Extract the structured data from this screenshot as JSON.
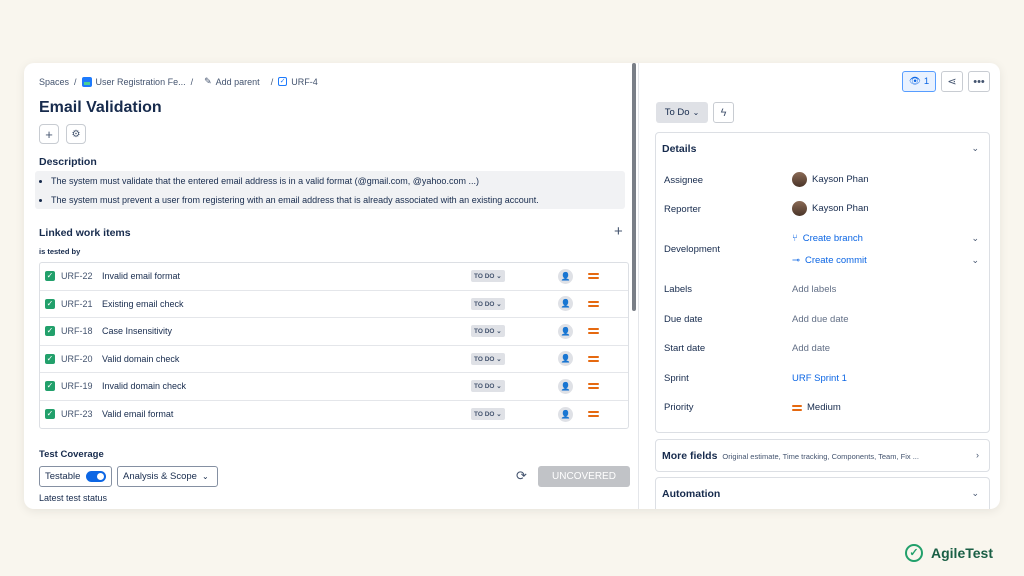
{
  "breadcrumb": {
    "spaces": "Spaces",
    "project": "User Registration Fe...",
    "add_parent": "Add parent",
    "issue_key": "URF-4",
    "separator": "/"
  },
  "issue": {
    "title": "Email Validation"
  },
  "description": {
    "heading": "Description",
    "items": [
      "The system must validate that the entered email address is in a valid format (@gmail.com, @yahoo.com ...)",
      "The system must prevent a user from registering with an email address that is already associated with an existing account."
    ]
  },
  "linked": {
    "heading": "Linked work items",
    "relation": "is tested by",
    "rows": [
      {
        "key": "URF-22",
        "summary": "Invalid email format",
        "status": "TO DO ⌄"
      },
      {
        "key": "URF-21",
        "summary": "Existing email check",
        "status": "TO DO ⌄"
      },
      {
        "key": "URF-18",
        "summary": "Case Insensitivity",
        "status": "TO DO ⌄"
      },
      {
        "key": "URF-20",
        "summary": "Valid domain check",
        "status": "TO DO ⌄"
      },
      {
        "key": "URF-19",
        "summary": "Invalid domain check",
        "status": "TO DO ⌄"
      },
      {
        "key": "URF-23",
        "summary": "Valid email format",
        "status": "TO DO ⌄"
      }
    ]
  },
  "test_coverage": {
    "heading": "Test Coverage",
    "testable_label": "Testable",
    "testable_on": true,
    "analysis_label": "Analysis & Scope",
    "status_button": "UNCOVERED",
    "latest_label": "Latest test status"
  },
  "header_actions": {
    "watch_count": "1"
  },
  "status": {
    "label": "To Do"
  },
  "details": {
    "heading": "Details",
    "assignee_label": "Assignee",
    "assignee": "Kayson Phan",
    "reporter_label": "Reporter",
    "reporter": "Kayson Phan",
    "development_label": "Development",
    "create_branch": "Create branch",
    "create_commit": "Create commit",
    "labels_label": "Labels",
    "labels_value": "Add labels",
    "due_label": "Due date",
    "due_value": "Add due date",
    "start_label": "Start date",
    "start_value": "Add date",
    "sprint_label": "Sprint",
    "sprint_value": "URF Sprint 1",
    "priority_label": "Priority",
    "priority_value": "Medium"
  },
  "more_fields": {
    "heading": "More fields",
    "sub": "Original estimate, Time tracking, Components, Team, Fix ..."
  },
  "automation": {
    "heading": "Automation"
  },
  "brand": {
    "name": "AgileTest"
  },
  "colors": {
    "accent": "#0c66e4",
    "story_green": "#22a06b",
    "priority_orange": "#e56910"
  }
}
